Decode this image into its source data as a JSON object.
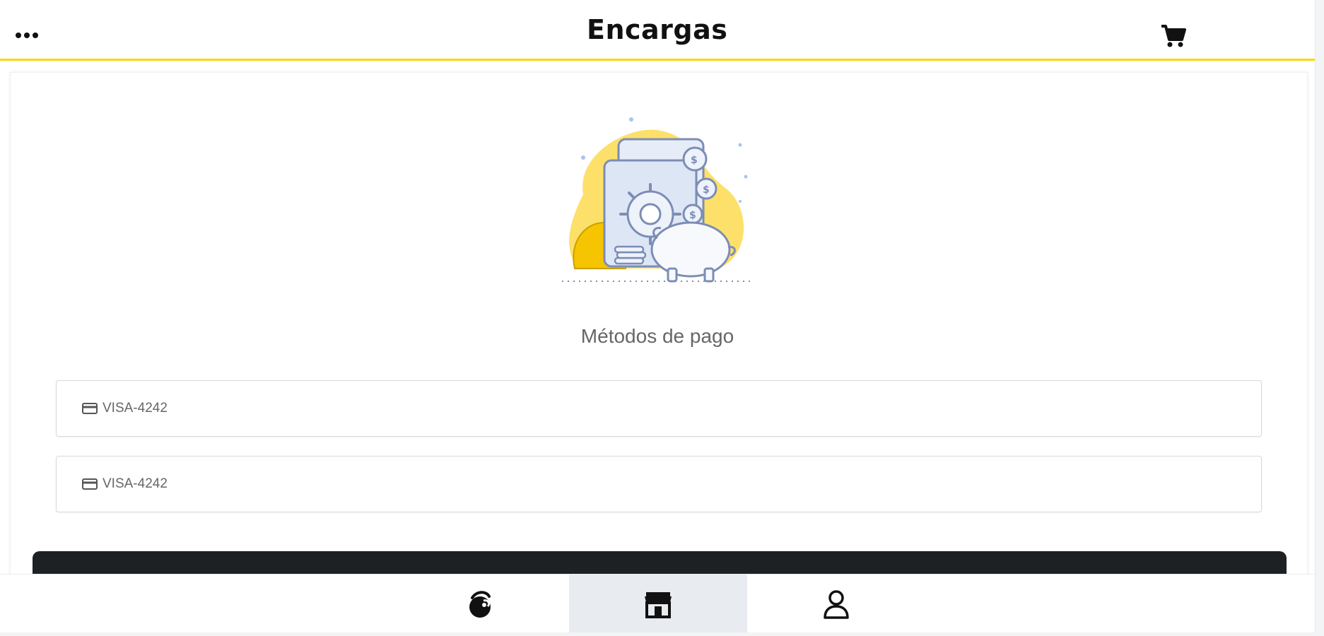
{
  "header": {
    "app_name": "Encargas",
    "menu_icon": "more-horizontal-icon",
    "cart_icon": "shopping-cart-icon"
  },
  "main": {
    "illustration": "safe-piggy-bank-coins-illustration",
    "title": "Métodos de pago",
    "payment_methods": [
      {
        "icon": "credit-card-icon",
        "label": "VISA-4242"
      },
      {
        "icon": "credit-card-icon",
        "label": "VISA-4242"
      }
    ]
  },
  "bottom_nav": {
    "items": [
      {
        "icon": "encargas-logo-icon",
        "active": false
      },
      {
        "icon": "store-icon",
        "active": true
      },
      {
        "icon": "user-icon",
        "active": false
      }
    ]
  },
  "colors": {
    "accent": "#f5d90a",
    "dark_button": "#1e2124",
    "active_nav_bg": "#e8ebf0"
  }
}
